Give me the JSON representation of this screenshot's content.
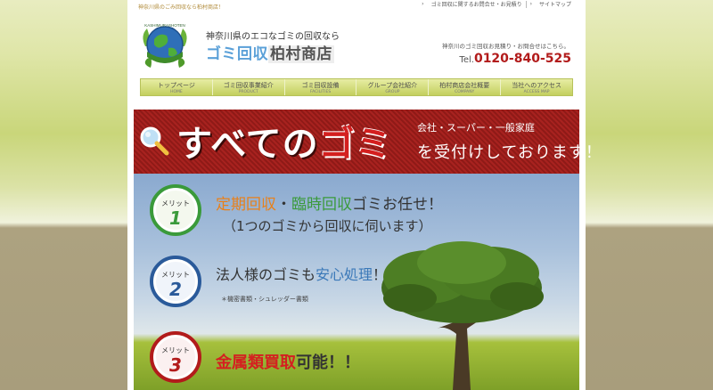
{
  "top": {
    "tagline": "神奈川県のごみ回収なら柏村商店！",
    "links": [
      "ゴミ回収に関するお問合せ・お見積り",
      "サイトマップ"
    ]
  },
  "logo": {
    "globe_text": "KASHIMURASHOTEN",
    "sub": "神奈川県のエコなゴミの回収なら",
    "name_a": "ゴミ回収",
    "name_b": "柏村商店"
  },
  "contact": {
    "note": "神奈川のゴミ回収お見積り・お問合せはこちら。",
    "tel_label": "Tel.",
    "tel": "0120-840-525"
  },
  "nav": [
    {
      "ja": "トップページ",
      "en": "HOME"
    },
    {
      "ja": "ゴミ回収事業紹介",
      "en": "PRODUCT"
    },
    {
      "ja": "ゴミ回収設備",
      "en": "FACILITIES"
    },
    {
      "ja": "グループ会社紹介",
      "en": "GROUP"
    },
    {
      "ja": "柏村商店会社概要",
      "en": "COMPANY"
    },
    {
      "ja": "当社へのアクセス",
      "en": "ACCESS MAP"
    }
  ],
  "banner": {
    "head_a": "すべての",
    "head_b": "ゴミ",
    "small": "会社・スーパー・一般家庭",
    "large": "を受付けしております！"
  },
  "merits": {
    "label": "メリット",
    "items": [
      {
        "num": "1",
        "color": "#3a9a3a"
      },
      {
        "num": "2",
        "color": "#2a5a9a"
      },
      {
        "num": "3",
        "color": "#b21b1b"
      }
    ],
    "m1": {
      "p1": "定期回収",
      "p2": "・",
      "p3": "臨時回収",
      "p4": "ゴミお任せ！",
      "sub": "（1つのゴミから回収に伺います）"
    },
    "m2": {
      "p1": "法人様のゴミも",
      "p2": "安心処理",
      "p3": "！",
      "sub": "＊機密書類・シュレッダー書類"
    },
    "m3": {
      "p1": "金属類買取",
      "p2": "可能！！"
    }
  },
  "colors": {
    "brand_red": "#b21b1b",
    "nav_green": "#c3cf5e",
    "banner_red": "#a8221f"
  }
}
